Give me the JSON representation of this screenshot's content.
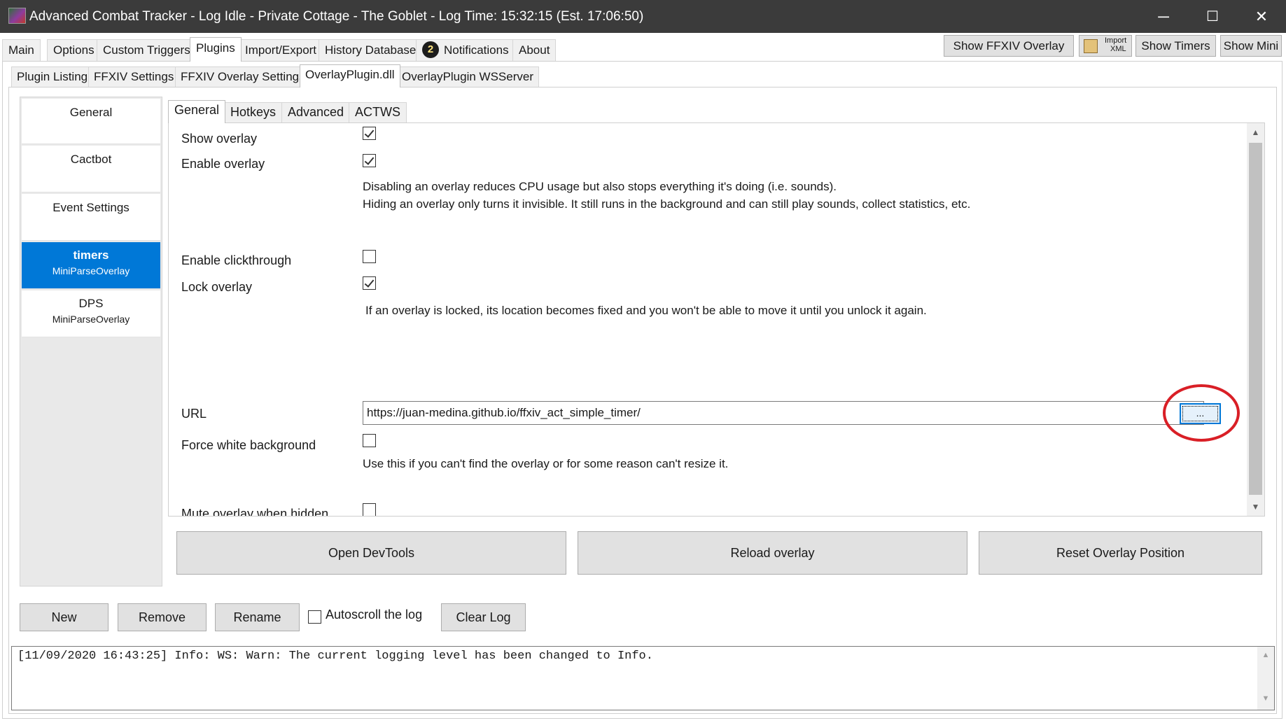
{
  "window": {
    "title": "Advanced Combat Tracker - Log Idle - Private Cottage - The Goblet - Log Time: 15:32:15 (Est. 17:06:50)",
    "minimize_glyph": "─",
    "maximize_glyph": "☐",
    "close_glyph": "✕"
  },
  "main_tabs": [
    "Main",
    "Options",
    "Custom Triggers",
    "Plugins",
    "Import/Export",
    "History Database",
    "Notifications",
    "About"
  ],
  "notification_badge": "2",
  "toolbar": {
    "show_ffxiv_overlay": "Show FFXIV Overlay",
    "import_xml_line1": "Import",
    "import_xml_line2": "XML",
    "show_timers": "Show Timers",
    "show_mini": "Show Mini"
  },
  "plugin_tabs": [
    "Plugin Listing",
    "FFXIV Settings",
    "FFXIV Overlay Settings",
    "OverlayPlugin.dll",
    "OverlayPlugin WSServer"
  ],
  "overlay_list": {
    "items": [
      {
        "name": "General",
        "type": ""
      },
      {
        "name": "Cactbot",
        "type": ""
      },
      {
        "name": "Event Settings",
        "type": ""
      },
      {
        "name": "timers",
        "type": "MiniParseOverlay"
      },
      {
        "name": "DPS",
        "type": "MiniParseOverlay"
      }
    ],
    "selected": "timers"
  },
  "settings_tabs": [
    "General",
    "Hotkeys",
    "Advanced",
    "ACTWS"
  ],
  "settings": {
    "show_overlay": {
      "label": "Show overlay",
      "checked": true
    },
    "enable_overlay": {
      "label": "Enable overlay",
      "checked": true
    },
    "enable_desc_line1": "Disabling an overlay reduces CPU usage but also stops everything it's doing (i.e. sounds).",
    "enable_desc_line2": "Hiding an overlay only turns it invisible. It still runs in the background and can still play sounds, collect statistics, etc.",
    "enable_clickthrough": {
      "label": "Enable clickthrough",
      "checked": false
    },
    "lock_overlay": {
      "label": "Lock overlay",
      "checked": true
    },
    "lock_desc": "If an overlay is locked, its location becomes fixed and you won't be able to move it until you unlock it again.",
    "url_label": "URL",
    "url_value": "https://juan-medina.github.io/ffxiv_act_simple_timer/",
    "browse_label": "...",
    "force_white": {
      "label": "Force white background",
      "checked": false
    },
    "force_white_desc": "Use this if you can't find the overlay or for some reason can't resize it.",
    "mute_hidden": {
      "label": "Mute overlay when hidden",
      "checked": false
    }
  },
  "action_buttons": {
    "devtools": "Open DevTools",
    "reload": "Reload overlay",
    "reset_position": "Reset Overlay Position"
  },
  "bottom_bar": {
    "new": "New",
    "remove": "Remove",
    "rename": "Rename",
    "autoscroll_label": "Autoscroll the log",
    "autoscroll_checked": false,
    "clear_log": "Clear Log"
  },
  "log": {
    "line": "[11/09/2020 16:43:25] Info: WS: Warn: The current logging level has been changed to Info."
  },
  "colors": {
    "titlebar": "#3b3b3b",
    "selection": "#0078d7",
    "annotation": "#d91f26"
  }
}
